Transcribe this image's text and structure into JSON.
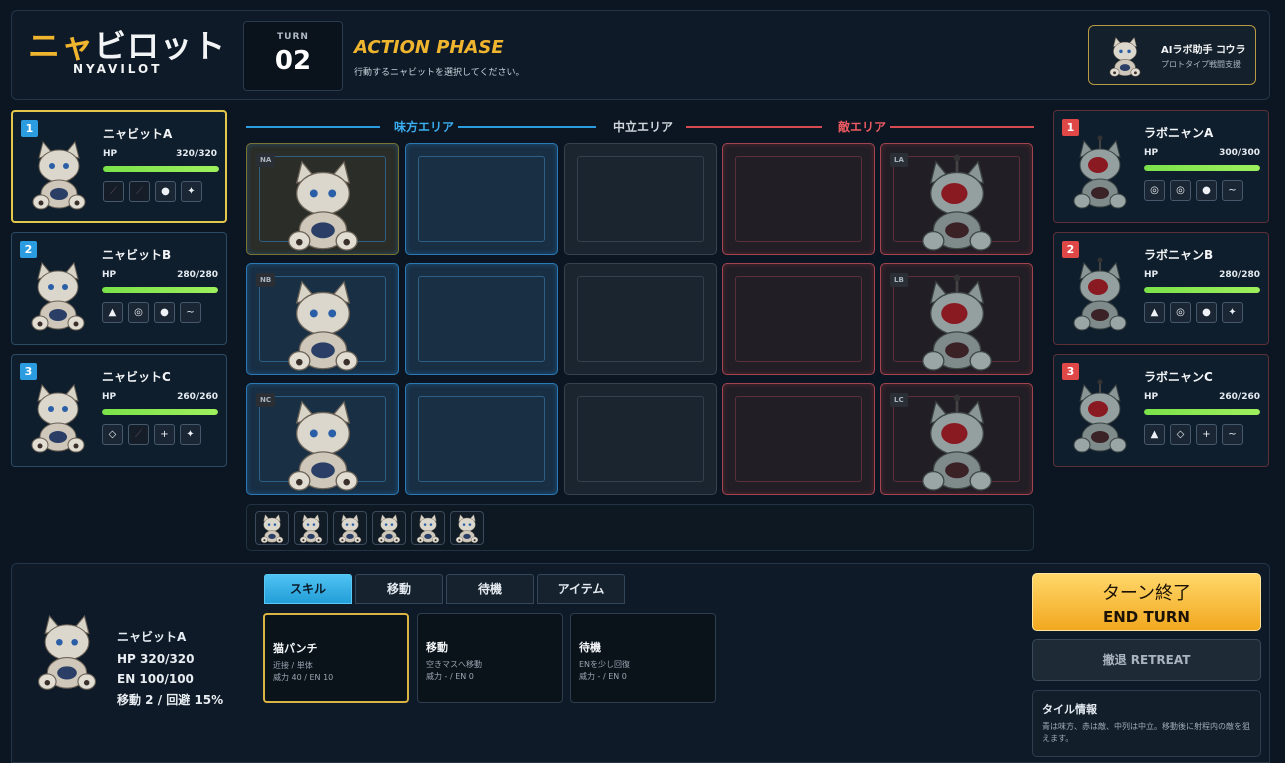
{
  "header": {
    "logo_jp_prefix": "ニャ",
    "logo_jp_rest": "ビロット",
    "logo_en": "NYAVILOT",
    "turn_label": "TURN",
    "turn_number": "02",
    "phase": "ACTION PHASE",
    "phase_hint": "行動するニャビットを選択してください。",
    "assistant_name": "AIラボ助手 コウラ",
    "assistant_role": "プロトタイプ戦闘支援"
  },
  "allies": [
    {
      "badge": "1",
      "name": "ニャビットA",
      "hp_label": "HP",
      "hp": "320/320",
      "hp_fraction": 1.0,
      "icons": [
        "⟋",
        "⟋",
        "●",
        "✦"
      ],
      "dim": [
        true,
        true,
        false,
        false
      ]
    },
    {
      "badge": "2",
      "name": "ニャビットB",
      "hp_label": "HP",
      "hp": "280/280",
      "hp_fraction": 1.0,
      "icons": [
        "▲",
        "◎",
        "●",
        "~"
      ],
      "dim": [
        false,
        false,
        false,
        false
      ]
    },
    {
      "badge": "3",
      "name": "ニャビットC",
      "hp_label": "HP",
      "hp": "260/260",
      "hp_fraction": 1.0,
      "icons": [
        "◇",
        "⟋",
        "+",
        "✦"
      ],
      "dim": [
        false,
        true,
        false,
        false
      ]
    }
  ],
  "enemies": [
    {
      "badge": "1",
      "name": "ラボニャンA",
      "hp_label": "HP",
      "hp": "300/300",
      "hp_fraction": 1.0,
      "icons": [
        "◎",
        "◎",
        "●",
        "~"
      ]
    },
    {
      "badge": "2",
      "name": "ラボニャンB",
      "hp_label": "HP",
      "hp": "280/280",
      "hp_fraction": 1.0,
      "icons": [
        "▲",
        "◎",
        "●",
        "✦"
      ]
    },
    {
      "badge": "3",
      "name": "ラボニャンC",
      "hp_label": "HP",
      "hp": "260/260",
      "hp_fraction": 1.0,
      "icons": [
        "▲",
        "◇",
        "+",
        "~"
      ]
    }
  ],
  "zones": {
    "ally": "味方エリア",
    "neutral": "中立エリア",
    "enemy": "敵エリア"
  },
  "tiles": {
    "ally_tags": [
      "NA",
      "NB",
      "NC"
    ],
    "enemy_tags": [
      "LA",
      "LB",
      "LC"
    ]
  },
  "colors": {
    "accent_gold": "#f0b52e",
    "ally_blue": "#2b9ce0",
    "enemy_red": "#e04848",
    "hp_green": "#7be24a"
  },
  "selected": {
    "name": "ニャビットA",
    "hp": "HP 320/320",
    "en": "EN 100/100",
    "move": "移動 2 / 回避 15%"
  },
  "tabs": [
    "スキル",
    "移動",
    "待機",
    "アイテム"
  ],
  "skills": [
    {
      "name": "猫パンチ",
      "line1": "近接 / 単体",
      "line2": "威力 40 / EN 10"
    },
    {
      "name": "移動",
      "line1": "空きマスへ移動",
      "line2": "威力 - / EN 0"
    },
    {
      "name": "待機",
      "line1": "ENを少し回復",
      "line2": "威力 - / EN 0"
    }
  ],
  "actions": {
    "end_turn_jp": "ターン終了",
    "end_turn_en": "END TURN",
    "retreat": "撤退 RETREAT"
  },
  "tile_info": {
    "title": "タイル情報",
    "body": "青は味方、赤は敵、中列は中立。移動後に射程内の敵を狙えます。"
  }
}
